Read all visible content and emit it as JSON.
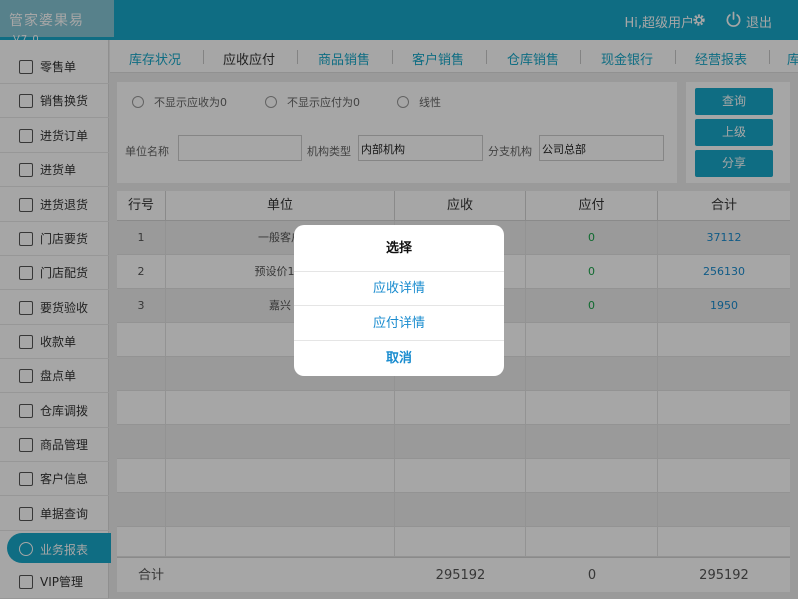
{
  "app": {
    "title": "管家婆果易",
    "version": "V7.0"
  },
  "topbar": {
    "greeting": "Hi,超级用户",
    "logout_label": "退出"
  },
  "sidebar": {
    "items": [
      {
        "label": "零售单",
        "icon": "receipt-icon"
      },
      {
        "label": "销售换货",
        "icon": "exchange-icon"
      },
      {
        "label": "进货订单",
        "icon": "purchase-order-icon"
      },
      {
        "label": "进货单",
        "icon": "purchase-icon"
      },
      {
        "label": "进货退货",
        "icon": "return-icon"
      },
      {
        "label": "门店要货",
        "icon": "store-request-icon"
      },
      {
        "label": "门店配货",
        "icon": "store-distribute-icon"
      },
      {
        "label": "要货验收",
        "icon": "inspect-icon"
      },
      {
        "label": "收款单",
        "icon": "payment-icon"
      },
      {
        "label": "盘点单",
        "icon": "stocktake-icon"
      },
      {
        "label": "仓库调拨",
        "icon": "transfer-icon"
      },
      {
        "label": "商品管理",
        "icon": "product-icon"
      },
      {
        "label": "客户信息",
        "icon": "customer-icon"
      },
      {
        "label": "单据查询",
        "icon": "search-icon"
      },
      {
        "label": "业务报表",
        "icon": "report-icon",
        "active": true
      },
      {
        "label": "VIP管理",
        "icon": "vip-icon"
      }
    ]
  },
  "tabs": [
    {
      "label": "库存状况"
    },
    {
      "label": "应收应付",
      "active": true
    },
    {
      "label": "商品销售"
    },
    {
      "label": "客户销售"
    },
    {
      "label": "仓库销售"
    },
    {
      "label": "现金银行"
    },
    {
      "label": "经营报表"
    },
    {
      "label": "库"
    }
  ],
  "filter": {
    "radios": [
      {
        "label": "不显示应收为0"
      },
      {
        "label": "不显示应付为0"
      },
      {
        "label": "线性"
      }
    ],
    "unit_name_label": "单位名称",
    "unit_name_value": "",
    "org_type_label": "机构类型",
    "org_type_value": "内部机构",
    "branch_label": "分支机构",
    "branch_value": "公司总部"
  },
  "buttons": {
    "query": "查询",
    "up": "上级",
    "share": "分享"
  },
  "table": {
    "headers": [
      "行号",
      "单位",
      "应收",
      "应付",
      "合计"
    ],
    "rows": [
      {
        "no": "1",
        "unit": "一般客户",
        "receivable": "",
        "payable": "0",
        "total": "37112"
      },
      {
        "no": "2",
        "unit": "预设价1客",
        "receivable": "",
        "payable": "0",
        "total": "256130"
      },
      {
        "no": "3",
        "unit": "嘉兴",
        "receivable": "",
        "payable": "0",
        "total": "1950"
      }
    ],
    "footer": {
      "label": "合计",
      "receivable": "295192",
      "payable": "0",
      "total": "295192"
    }
  },
  "dialog": {
    "title": "选择",
    "options": [
      "应收详情",
      "应付详情",
      "取消"
    ]
  },
  "colors": {
    "accent": "#17a8c9",
    "link": "#1a8ccf",
    "positive": "#1aa34a"
  }
}
